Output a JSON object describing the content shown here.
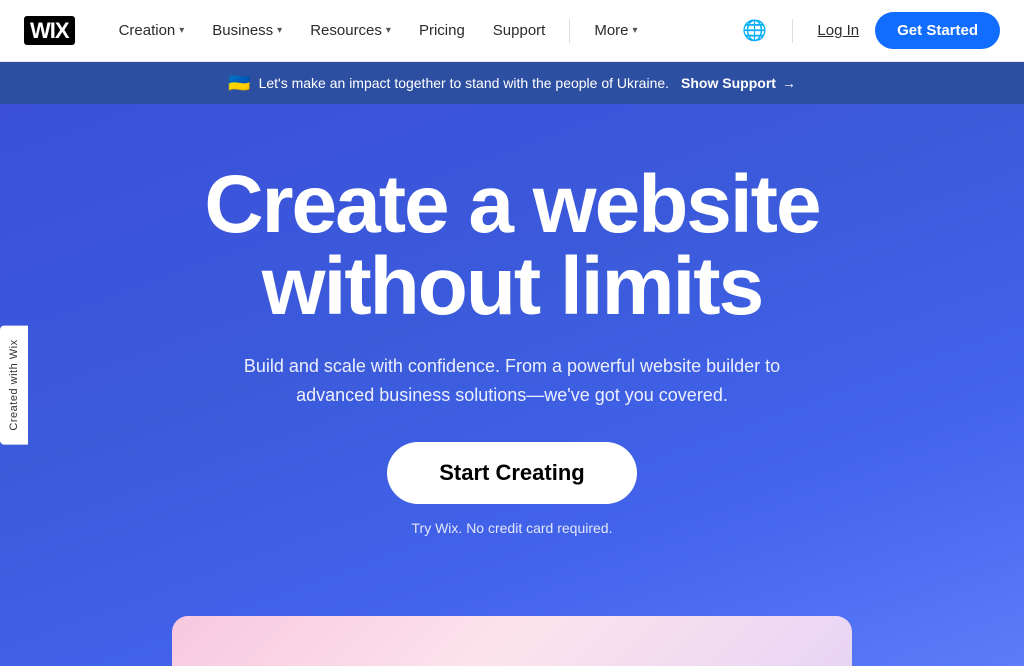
{
  "logo": {
    "text": "WIX"
  },
  "navbar": {
    "items": [
      {
        "label": "Creation",
        "has_dropdown": true
      },
      {
        "label": "Business",
        "has_dropdown": true
      },
      {
        "label": "Resources",
        "has_dropdown": true
      },
      {
        "label": "Pricing",
        "has_dropdown": false
      },
      {
        "label": "Support",
        "has_dropdown": false
      },
      {
        "label": "More",
        "has_dropdown": true
      }
    ],
    "login_label": "Log In",
    "get_started_label": "Get Started"
  },
  "ukraine_banner": {
    "flag_emoji": "🇺🇦",
    "text": "Let's make an impact together to stand with the people of Ukraine.",
    "link_text": "Show Support",
    "arrow": "→"
  },
  "hero": {
    "title_line1": "Create a website",
    "title_line2": "without limits",
    "subtitle": "Build and scale with confidence. From a powerful website builder to advanced business solutions—we've got you covered.",
    "cta_label": "Start Creating",
    "try_note": "Try Wix. No credit card required."
  },
  "side_label": {
    "text": "Created with Wix"
  }
}
